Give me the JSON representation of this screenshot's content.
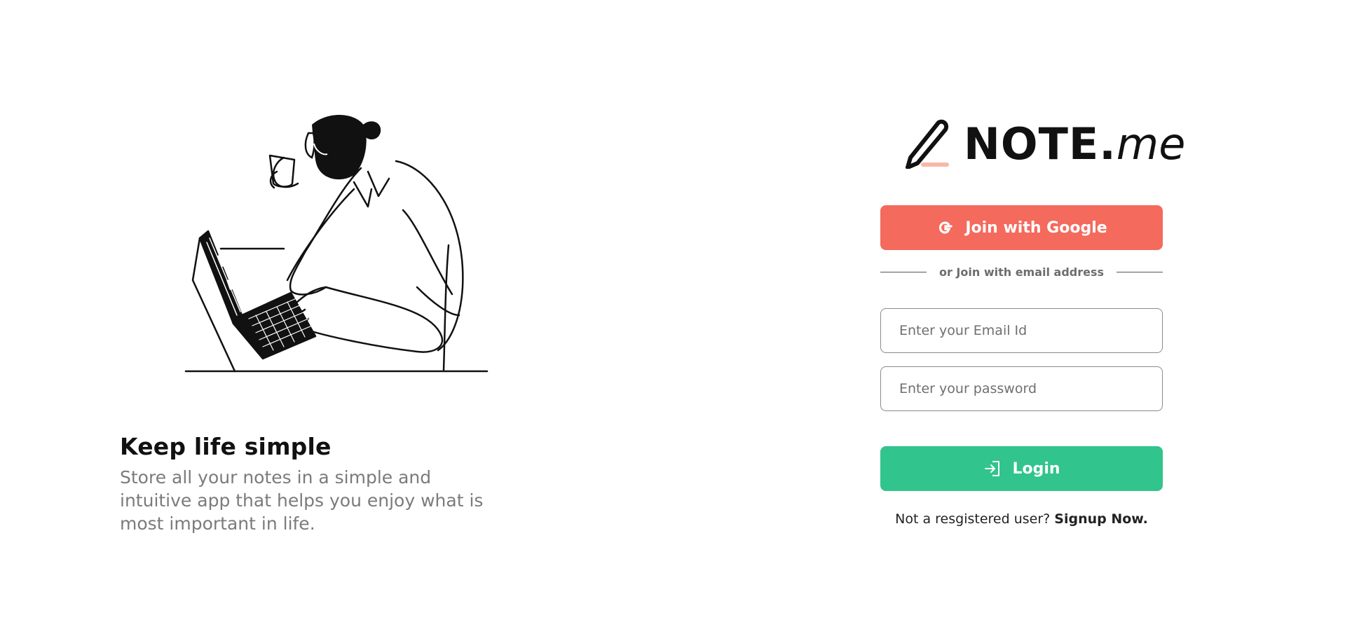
{
  "hero": {
    "title": "Keep life simple",
    "description": "Store all your notes in a simple and intuitive app that helps you enjoy what is most important in life."
  },
  "logo": {
    "brand": "NOTE.",
    "suffix": "me",
    "icon": "pencil-icon"
  },
  "auth": {
    "google_button_label": "Join with Google",
    "google_icon": "google-icon",
    "divider_text": "or Join with email address",
    "email_placeholder": "Enter your Email Id",
    "password_placeholder": "Enter your password",
    "login_button_label": "Login",
    "login_icon": "login-icon",
    "signup_prompt": "Not a resgistered user?",
    "signup_link": "Signup Now."
  },
  "colors": {
    "google_button": "#f46a5d",
    "login_button": "#31c48d",
    "pencil_accent": "#f7b8a8"
  }
}
